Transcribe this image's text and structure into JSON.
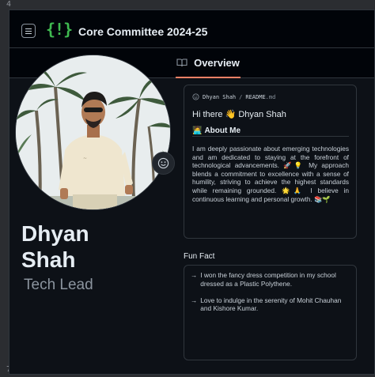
{
  "gutter": {
    "top": "4",
    "bottom": "7"
  },
  "header": {
    "logo_text": "{!}",
    "title": "Core Committee 2024-25"
  },
  "tabs": [
    {
      "label": "Overview",
      "icon": "book-icon",
      "active": true
    }
  ],
  "profile": {
    "name_line1": "Dhyan",
    "name_line2": "Shah",
    "role": "Tech Lead",
    "status_icon": "smiley-icon"
  },
  "readme": {
    "owner": "Dhyan Shah",
    "separator": "/",
    "file_name": "README",
    "file_ext": ".md",
    "greeting": "Hi there 👋 Dhyan Shah",
    "about_heading": "About Me",
    "about_icon": "🧑‍💻",
    "about_text": "I am deeply passionate about emerging technologies and am dedicated to staying at the forefront of technological advancements. 🚀💡 My approach blends a commitment to excellence with a sense of humility, striving to achieve the highest standards while remaining grounded. 🌟🙏 I believe in continuous learning and personal growth. 📚🌱"
  },
  "fun_fact": {
    "title": "Fun Fact",
    "items": [
      {
        "arrow": "→",
        "text": "I won the fancy dress competition in my school dressed as a Plastic Polythene."
      },
      {
        "arrow": "→",
        "text": "Love to indulge in the serenity of Mohit Chauhan and Kishore Kumar."
      }
    ]
  },
  "colors": {
    "accent_green": "#3fb950",
    "tab_underline": "#f78166",
    "background": "#0d1117",
    "border": "#30363d"
  }
}
